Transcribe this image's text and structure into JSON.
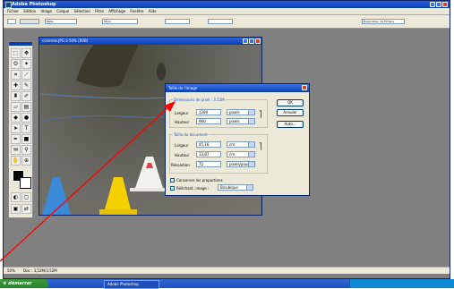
{
  "app": {
    "title": "Adobe Photoshop"
  },
  "menu": [
    "Fichier",
    "Edition",
    "Image",
    "Calque",
    "Sélection",
    "Filtre",
    "Affichage",
    "Fenêtre",
    "Aide"
  ],
  "options": {
    "sample_label": "Taille",
    "style_label": "Style",
    "brush_label": "Explorateur de fichiers"
  },
  "document": {
    "title": "ccorrese.JPG à 50% (RVB)"
  },
  "dialog": {
    "title": "Taille de l'image",
    "pixel_dims": {
      "label": "Dimensions de pixel : 3.52M",
      "width_label": "Largeur",
      "width_value": "1280",
      "height_label": "Hauteur",
      "height_value": "960",
      "unit": "pixels"
    },
    "doc_size": {
      "label": "Taille du document",
      "width_label": "Largeur",
      "width_value": "45,16",
      "width_unit": "cm",
      "height_label": "Hauteur",
      "height_value": "33,87",
      "height_unit": "cm",
      "res_label": "Résolution",
      "res_value": "72",
      "res_unit": "pixels/pouce"
    },
    "constrain_label": "Conserver les proportions",
    "resample_label": "Rééchant. image :",
    "resample_value": "Bicubique",
    "buttons": {
      "ok": "OK",
      "cancel": "Annuler",
      "auto": "Auto..."
    }
  },
  "status": {
    "zoom": "50%",
    "doc": "Doc : 3,52M/3,52M"
  },
  "taskbar": {
    "start": "démarrer",
    "task": "Adobe Photoshop"
  },
  "colors": {
    "title_blue": "#0a3fb0",
    "arrow_red": "#ff0000",
    "cone_yellow": "#f5d000",
    "cone_blue": "#3a8ad8",
    "cone_white": "#f2f2ee",
    "cone_red": "#e84040"
  }
}
